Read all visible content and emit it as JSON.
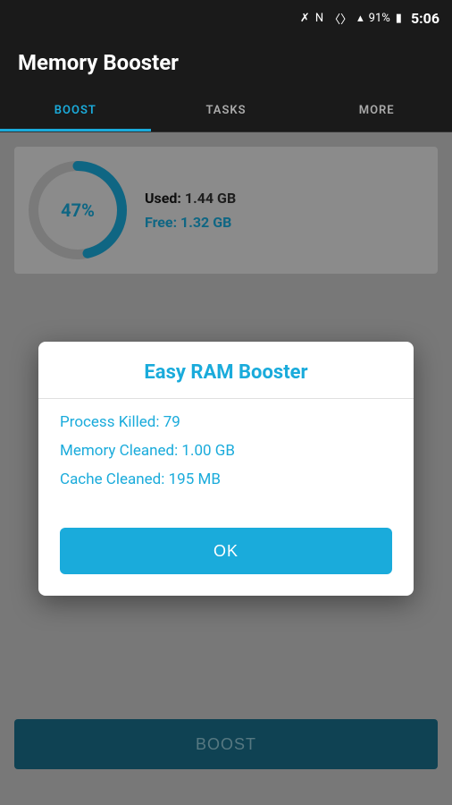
{
  "statusBar": {
    "battery": "91%",
    "time": "5:06"
  },
  "header": {
    "title": "Memory Booster"
  },
  "tabs": [
    {
      "id": "boost",
      "label": "BOOST",
      "active": true
    },
    {
      "id": "tasks",
      "label": "TASKS",
      "active": false
    },
    {
      "id": "more",
      "label": "MORE",
      "active": false
    }
  ],
  "memoryDisplay": {
    "percent": "47%",
    "usedLabel": "Used:",
    "usedValue": "1.44 GB",
    "freeLabel": "Free:",
    "freeValue": "1.32 GB"
  },
  "boostButton": {
    "label": "Boost"
  },
  "dialog": {
    "title": "Easy RAM Booster",
    "stats": [
      {
        "label": "Process Killed:",
        "value": "79"
      },
      {
        "label": "Memory Cleaned:",
        "value": "1.00 GB"
      },
      {
        "label": "Cache Cleaned:",
        "value": "195 MB"
      }
    ],
    "okLabel": "OK"
  }
}
